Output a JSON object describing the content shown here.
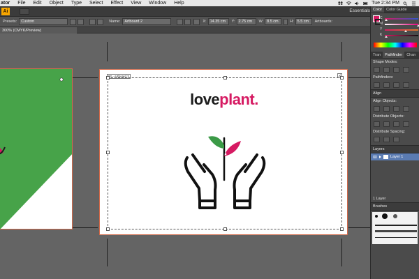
{
  "menubar": {
    "app_name": "ator",
    "menus": [
      "File",
      "Edit",
      "Object",
      "Type",
      "Select",
      "Effect",
      "View",
      "Window",
      "Help"
    ],
    "clock": "Tue 2:34 PM"
  },
  "appbar": {
    "logo_text": "Ai",
    "workspace": "Essentials"
  },
  "control_bar": {
    "presets_label": "Presets:",
    "presets_value": "Custom",
    "name_label": "Name:",
    "name_value": "Artboard 2",
    "x_label": "X:",
    "x_value": "14.35 cm",
    "y_label": "Y:",
    "y_value": "2.75 cm",
    "w_label": "W:",
    "w_value": "8.5 cm",
    "h_label": "H:",
    "h_value": "5.5 cm",
    "artboards_label": "Artboards:"
  },
  "document_tab": "300% (CMYK/Preview)",
  "artboard2": {
    "label": "02 - Artboard 2",
    "logo_text_dark": "love",
    "logo_text_pink": "plant."
  },
  "colors": {
    "brand_pink": "#d61a62",
    "leaf_green": "#3b9a47",
    "artboard1_green": "#47a349",
    "artboard_border": "#d46a4a"
  },
  "panels": {
    "color_tabs": [
      "Color",
      "Color Guide"
    ],
    "color_sliders": [
      {
        "label": "C",
        "value": 0
      },
      {
        "label": "M",
        "value": 1
      },
      {
        "label": "Y",
        "value": 0.6
      },
      {
        "label": "K",
        "value": 0
      }
    ],
    "pathfinder_tabs": [
      "Tran",
      "Pathfinder",
      "Chan"
    ],
    "shape_modes": "Shape Modes:",
    "pathfinders": "Pathfinders:",
    "align_title": "Align",
    "align_objects": "Align Objects:",
    "distribute_objects": "Distribute Objects:",
    "distribute_spacing": "Distribute Spacing:",
    "align_to": "Align To:",
    "layers_title": "Layers",
    "layer_name": "Layer 1",
    "layers_count": "1 Layer",
    "brushes_title": "Brushes"
  }
}
